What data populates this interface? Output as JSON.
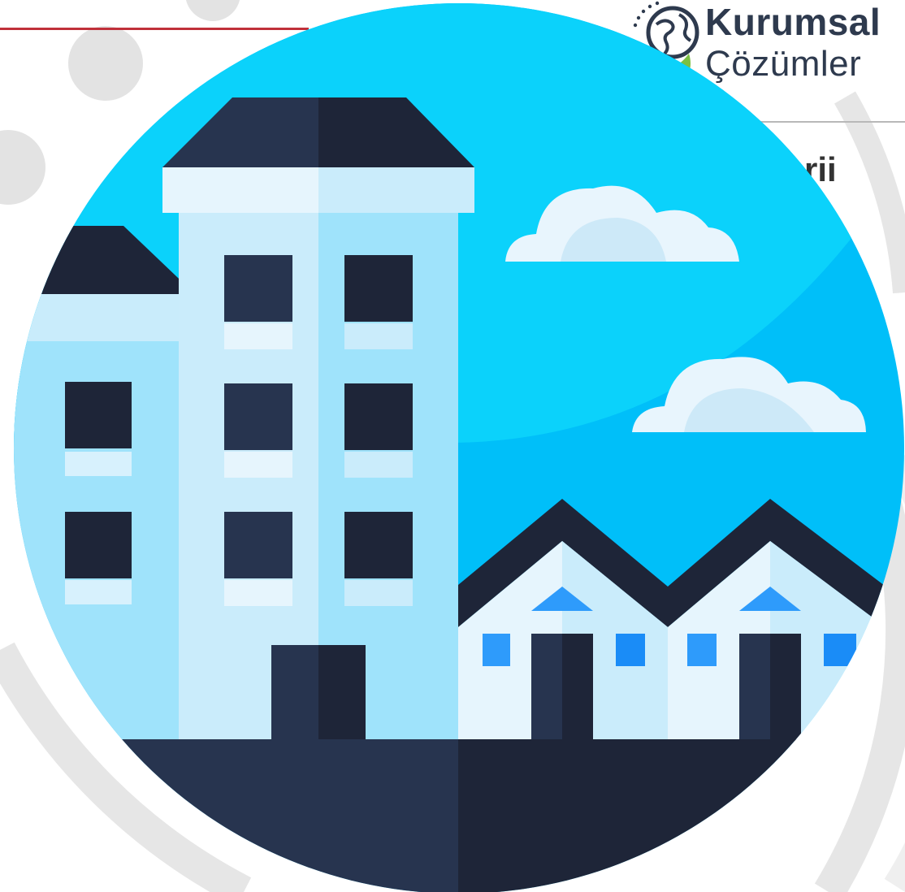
{
  "logo": {
    "line1": "Kurumsal",
    "line2": "Çözümler",
    "icon": "globe-icon",
    "accent_color": "#7bc043"
  },
  "page": {
    "partial_heading": "rii"
  },
  "illustration": {
    "name": "city-buildings-illustration",
    "sky_color": "#00c4fa",
    "ground_color": "#27344f"
  },
  "colors": {
    "accent_red": "#c0303a",
    "text_dark": "#2e3a4e"
  }
}
